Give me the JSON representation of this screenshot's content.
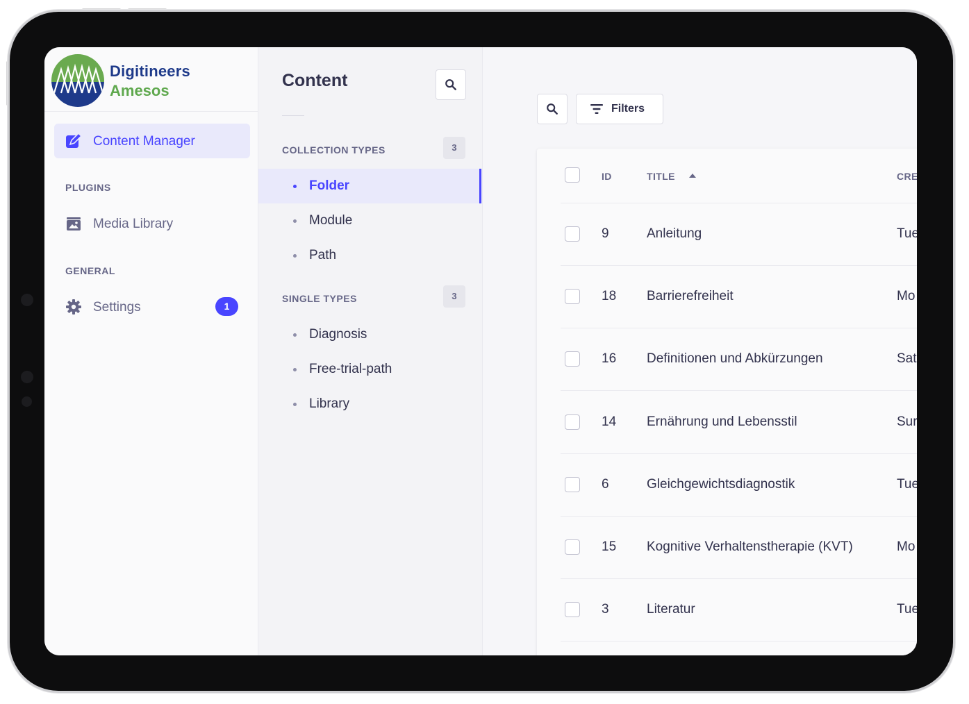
{
  "brand": {
    "name": "Digitineers",
    "sub": "Amesos"
  },
  "leftnav": {
    "active_item": "Content Manager",
    "plugins_label": "PLUGINS",
    "media_library": "Media Library",
    "general_label": "GENERAL",
    "settings": "Settings",
    "settings_badge": "1"
  },
  "subnav": {
    "title": "Content",
    "collection_types_label": "COLLECTION TYPES",
    "collection_types_count": "3",
    "collection_types": [
      "Folder",
      "Module",
      "Path"
    ],
    "single_types_label": "SINGLE TYPES",
    "single_types_count": "3",
    "single_types": [
      "Diagnosis",
      "Free-trial-path",
      "Library"
    ]
  },
  "toolbar": {
    "filters_label": "Filters"
  },
  "table": {
    "headers": {
      "id": "ID",
      "title": "TITLE",
      "created": "CRE"
    },
    "rows": [
      {
        "id": "9",
        "title": "Anleitung",
        "created": "Tue"
      },
      {
        "id": "18",
        "title": "Barrierefreiheit",
        "created": "Mo"
      },
      {
        "id": "16",
        "title": "Definitionen und Abkürzungen",
        "created": "Sat"
      },
      {
        "id": "14",
        "title": "Ernährung und Lebensstil",
        "created": "Sur"
      },
      {
        "id": "6",
        "title": "Gleichgewichtsdiagnostik",
        "created": "Tue"
      },
      {
        "id": "15",
        "title": "Kognitive Verhaltenstherapie (KVT)",
        "created": "Mo"
      },
      {
        "id": "3",
        "title": "Literatur",
        "created": "Tue"
      }
    ]
  },
  "colors": {
    "accent": "#4945ff",
    "brand_blue": "#1e3a8a",
    "brand_green": "#5fa84e"
  }
}
